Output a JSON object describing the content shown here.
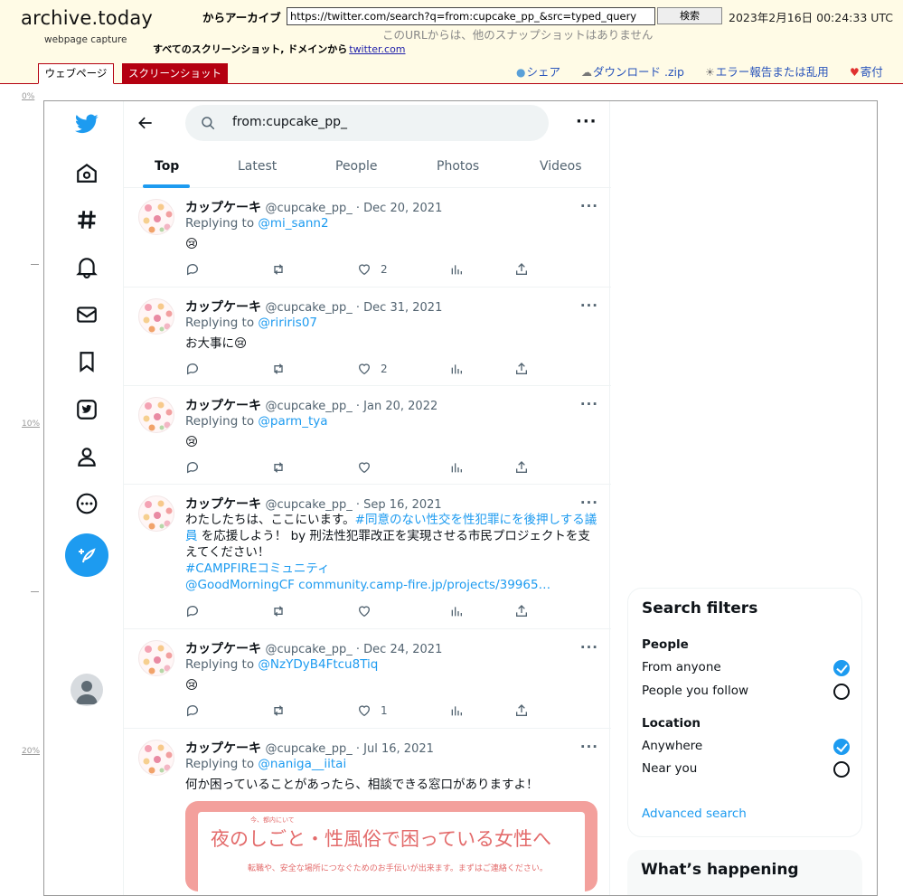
{
  "archive": {
    "logo": "archive.today",
    "subtitle": "webpage capture",
    "from_label": "からアーカイブ",
    "url_value": "https://twitter.com/search?q=from:cupcake_pp_&src=typed_query",
    "search_button": "検索",
    "datetime": "2023年2月16日 00:24:33 UTC",
    "no_snapshots": "このURLからは、他のスナップショットはありません",
    "all_screenshots": "すべてのスクリーンショット, ドメインから",
    "domain_link": "twitter.com",
    "tab_webpage": "ウェブページ",
    "tab_screenshot": "スクリーンショット",
    "links": {
      "share": "シェア",
      "download": "ダウンロード .zip",
      "report": "エラー報告または乱用",
      "donate": "寄付"
    },
    "ruler": [
      "0%",
      "10%",
      "20%"
    ]
  },
  "search": {
    "query": "from:cupcake_pp_"
  },
  "tabs": [
    "Top",
    "Latest",
    "People",
    "Photos",
    "Videos"
  ],
  "tweets": [
    {
      "name": "カップケーキ",
      "meta": "@cupcake_pp_ · Dec 20, 2021",
      "reply_prefix": "Replying to ",
      "reply_to": "@mi_sann2",
      "text": "😢",
      "likes": "2"
    },
    {
      "name": "カップケーキ",
      "meta": "@cupcake_pp_ · Dec 31, 2021",
      "reply_prefix": "Replying to ",
      "reply_to": "@ririris07",
      "text": "お大事に😢",
      "likes": "2"
    },
    {
      "name": "カップケーキ",
      "meta": "@cupcake_pp_ · Jan 20, 2022",
      "reply_prefix": "Replying to ",
      "reply_to": "@parm_tya",
      "text": "😢",
      "likes": ""
    },
    {
      "name": "カップケーキ",
      "meta": "@cupcake_pp_ · Sep 16, 2021",
      "text_plain_1": "わたしたちは、ここにいます。",
      "text_link_1": "#同意のない性交を性犯罪にを後押しする議員",
      "text_plain_2": " を応援しよう！ by 刑法性犯罪改正を実現させる市民プロジェクトを支えてください！",
      "text_link_2": "#CAMPFIREコミュニティ",
      "text_link_3": "@GoodMorningCF community.camp-fire.jp/projects/39965…",
      "likes": ""
    },
    {
      "name": "カップケーキ",
      "meta": "@cupcake_pp_ · Dec 24, 2021",
      "reply_prefix": "Replying to ",
      "reply_to": "@NzYDyB4Ftcu8Tiq",
      "text": "😢",
      "likes": "1"
    },
    {
      "name": "カップケーキ",
      "meta": "@cupcake_pp_ · Jul 16, 2021",
      "reply_prefix": "Replying to ",
      "reply_to": "@naniga__iitai",
      "text": "何か困っていることがあったら、相談できる窓口がありますよ！",
      "image_small": "今、都内にいて",
      "image_title": "夜のしごと・性風俗で困っている女性へ",
      "image_sub": "転職や、安全な場所につなぐためのお手伝いが出来ます。まずはご連絡ください。"
    }
  ],
  "filters": {
    "title": "Search filters",
    "people_label": "People",
    "people_options": [
      "From anyone",
      "People you follow"
    ],
    "location_label": "Location",
    "location_options": [
      "Anywhere",
      "Near you"
    ],
    "advanced": "Advanced search"
  },
  "happening": {
    "title": "What’s happening"
  },
  "colors": {
    "twitter_blue": "#1d9bf0",
    "archive_red": "#b40010",
    "archive_bg": "#fffbe6"
  }
}
